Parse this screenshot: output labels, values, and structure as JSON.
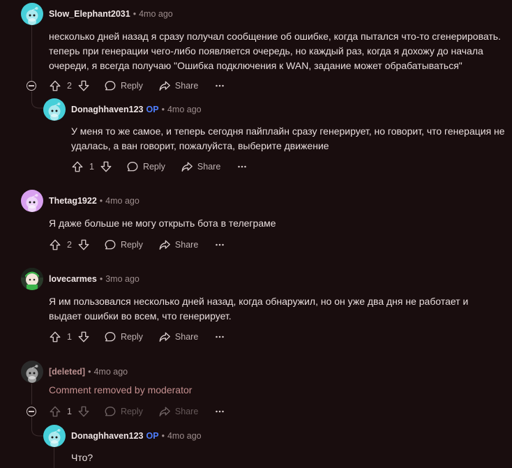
{
  "comments": [
    {
      "username": "Slow_Elephant2031",
      "time": "4mo ago",
      "body": "несколько дней назад я сразу получал сообщение об ошибке, когда пытался что-то сгенерировать. теперь при генерации чего-либо появляется очередь, но каждый раз, когда я дохожу до начала очереди, я всегда получаю \"Ошибка подключения к WAN, задание может обрабатываться\"",
      "score": "2",
      "reply_label": "Reply",
      "share_label": "Share",
      "avatar_color": "#46cfd9",
      "replies": [
        {
          "username": "Donaghhaven123",
          "op_badge": "OP",
          "time": "4mo ago",
          "body": "У меня то же самое, и теперь сегодня пайплайн сразу генерирует, но говорит, что генерация не удалась, а ван говорит, пожалуйста, выберите движение",
          "score": "1",
          "reply_label": "Reply",
          "share_label": "Share",
          "avatar_color": "#46cfd9"
        }
      ]
    },
    {
      "username": "Thetag1922",
      "time": "4mo ago",
      "body": "Я даже больше не могу открыть бота в телеграме",
      "score": "2",
      "reply_label": "Reply",
      "share_label": "Share",
      "avatar_color": "#d9a0f0"
    },
    {
      "username": "lovecarmes",
      "time": "3mo ago",
      "body": "Я им пользовался несколько дней назад, когда обнаружил, но он уже два дня не работает и выдает ошибки во всем, что генерирует.",
      "score": "1",
      "reply_label": "Reply",
      "share_label": "Share",
      "avatar_color": "#2a3a2a"
    },
    {
      "username": "[deleted]",
      "time": "4mo ago",
      "body": "Comment removed by moderator",
      "score": "1",
      "reply_label": "Reply",
      "share_label": "Share",
      "avatar_color": "#2b2b2b",
      "replies": [
        {
          "username": "Donaghhaven123",
          "op_badge": "OP",
          "time": "4mo ago",
          "body": "Что?",
          "avatar_color": "#46cfd9"
        }
      ]
    }
  ],
  "icons": {
    "upvote": "arrow-up-icon",
    "downvote": "arrow-down-icon",
    "reply": "speech-bubble-icon",
    "share": "share-arrow-icon",
    "more": "ellipsis-icon",
    "collapse": "collapse-minus-icon",
    "avatar": "snoo-avatar-icon"
  },
  "colors": {
    "background": "#190d0e",
    "op_badge": "#4f7fff",
    "removed_text": "#c48f8f",
    "muted": "#9c8c8c"
  }
}
